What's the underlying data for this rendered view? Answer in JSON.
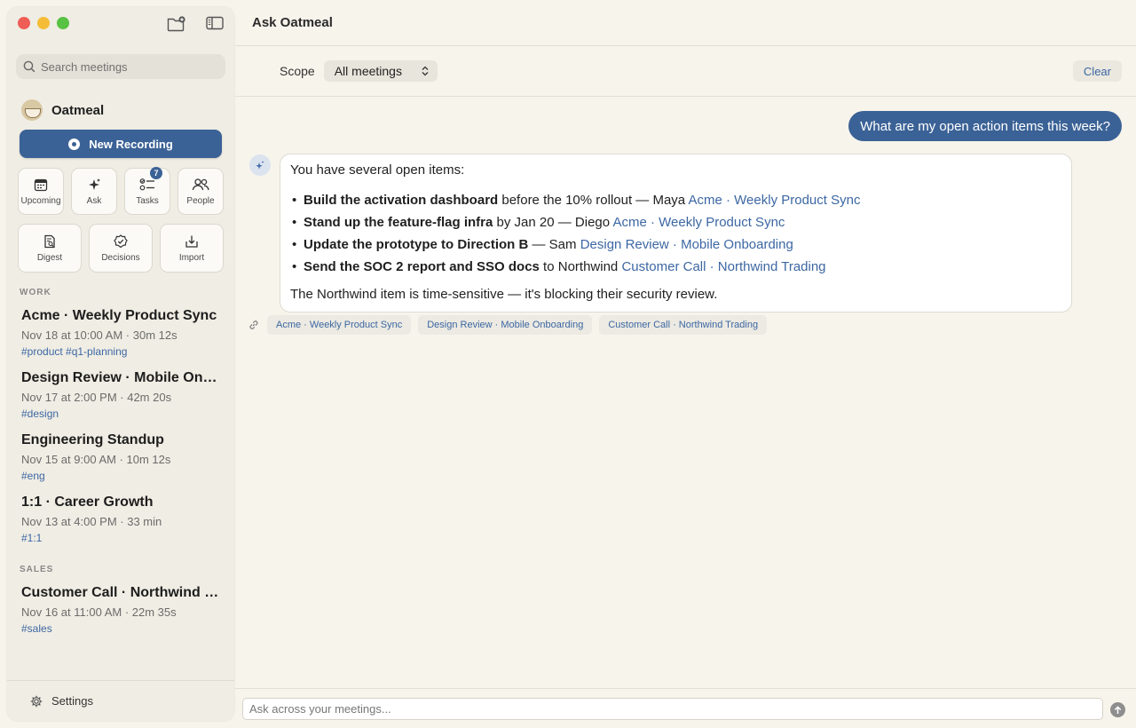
{
  "sidebar": {
    "search_placeholder": "Search meetings",
    "brand": "Oatmeal",
    "new_recording": "New Recording",
    "tiles": [
      {
        "label": "Upcoming"
      },
      {
        "label": "Ask"
      },
      {
        "label": "Tasks",
        "badge": "7"
      },
      {
        "label": "People"
      },
      {
        "label": "Digest"
      },
      {
        "label": "Decisions"
      },
      {
        "label": "Import"
      }
    ],
    "sections": [
      {
        "label": "WORK",
        "meetings": [
          {
            "title": "Acme · Weekly Product Sync",
            "meta": "Nov 18 at 10:00 AM  ·  30m 12s",
            "tags": "#product #q1-planning"
          },
          {
            "title": "Design Review · Mobile Onboarding",
            "meta": "Nov 17 at 2:00 PM  ·  42m 20s",
            "tags": "#design"
          },
          {
            "title": "Engineering Standup",
            "meta": "Nov 15 at 9:00 AM  ·  10m 12s",
            "tags": "#eng"
          },
          {
            "title": "1:1 · Career Growth",
            "meta": "Nov 13 at 4:00 PM  ·  33 min",
            "tags": "#1:1"
          }
        ]
      },
      {
        "label": "SALES",
        "meetings": [
          {
            "title": "Customer Call · Northwind Trading",
            "meta": "Nov 16 at 11:00 AM  ·  22m 35s",
            "tags": "#sales"
          }
        ]
      }
    ],
    "settings": "Settings"
  },
  "main": {
    "title": "Ask Oatmeal",
    "scope_label": "Scope",
    "scope_value": "All meetings",
    "clear": "Clear",
    "user_message": "What are my open action items this week?",
    "answer": {
      "intro": "You have several open items:",
      "items": [
        {
          "bold": "Build the activation dashboard",
          "rest": " before the 10% rollout — Maya ",
          "link": "Acme · Weekly Product Sync"
        },
        {
          "bold": "Stand up the feature-flag infra",
          "rest": " by Jan 20 — Diego ",
          "link": "Acme · Weekly Product Sync"
        },
        {
          "bold": "Update the prototype to Direction B",
          "rest": " — Sam ",
          "link": "Design Review · Mobile Onboarding"
        },
        {
          "bold": "Send the SOC 2 report and SSO docs",
          "rest": " to Northwind ",
          "link": "Customer Call · Northwind Trading"
        }
      ],
      "closing": "The Northwind item is time-sensitive — it's blocking their security review."
    },
    "sources": [
      "Acme · Weekly Product Sync",
      "Design Review · Mobile Onboarding",
      "Customer Call · Northwind Trading"
    ],
    "composer_placeholder": "Ask across your meetings..."
  },
  "colors": {
    "accent": "#3b6296",
    "link": "#3c67a3",
    "background": "#f7f4ec",
    "sidebar": "#f0ede4"
  }
}
